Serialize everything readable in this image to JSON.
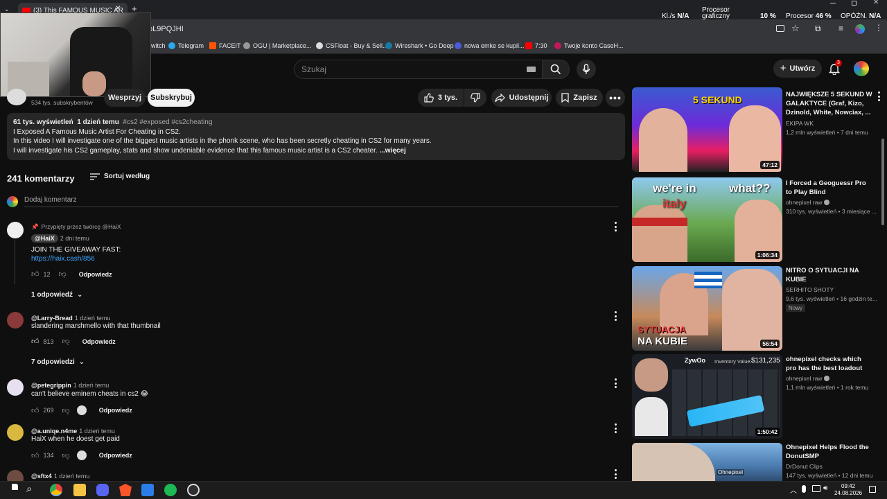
{
  "browser": {
    "tab_title": "(3) This FAMOUS MUSIC AR",
    "url_fragment": "oL9PQJHI",
    "bookmarks": [
      "witch",
      "Telegram",
      "FACEIT",
      "OGU | Marketplace...",
      "CSFloat - Buy & Sell...",
      "Wireshark • Go Deep",
      "nowa emke se kupil...",
      "7:30",
      "Twoje konto CaseH..."
    ]
  },
  "perf": {
    "kl_label": "Kl./s",
    "kl_value": "N/A",
    "gpu_label_1": "Procesor",
    "gpu_label_2": "graficzny",
    "gpu_value": "10 %",
    "cpu_label": "Procesor",
    "cpu_value": "46 %",
    "lag_label": "OPÓŹN.",
    "lag_value": "N/A"
  },
  "youtube": {
    "search_placeholder": "Szukaj",
    "create_label": "Utwórz",
    "notifications_count": "3"
  },
  "channel": {
    "subscribers": "534 tys. subskrybentów",
    "support_label": "Wesprzyj",
    "subscribe_label": "Subskrybuj"
  },
  "actions": {
    "likes": "3 tys.",
    "share": "Udostępnij",
    "save": "Zapisz"
  },
  "description": {
    "views": "61 tys. wyświetleń",
    "date": "1 dzień temu",
    "tags": "#cs2 #exposed #cs2cheating",
    "line1": "I Exposed A Famous Music Artist For Cheating in CS2.",
    "line2": "In this video I will investigate one of the biggest music artists in the phonk scene, who has been secretly cheating in CS2 for many years.",
    "line3": "I will investigate his CS2 gameplay, stats and show undeniable evidence that this famous music artist is a CS2 cheater.",
    "more": "...więcej"
  },
  "comments_header": {
    "count": "241 komentarzy",
    "sort": "Sortuj według",
    "add_placeholder": "Dodaj komentarz"
  },
  "comments": [
    {
      "pinned": "Przypięty przez twórcę @HaiX",
      "handle": "@HaiX",
      "time": "2 dni temu",
      "text": "JOIN THE GIVEAWAY FAST:",
      "link": "https://haix.cash/856",
      "likes": "12",
      "reply": "Odpowiedz",
      "replies": "1 odpowiedź"
    },
    {
      "handle": "@Larry-Bread",
      "time": "1 dzień temu",
      "text": "slandering marshmello with that thumbnail",
      "likes": "813",
      "reply": "Odpowiedz",
      "replies": "7 odpowiedzi"
    },
    {
      "handle": "@petegrippin",
      "time": "1 dzień temu",
      "text": "can't believe eminem cheats in cs2 😂",
      "likes": "269",
      "reply": "Odpowiedz"
    },
    {
      "handle": "@a.uniqe.n4me",
      "time": "1 dzień temu",
      "text": "HaiX when he doest get paid",
      "likes": "134",
      "reply": "Odpowiedz"
    },
    {
      "handle": "@sftx4",
      "time": "1 dzień temu"
    }
  ],
  "sidebar": [
    {
      "title": "NAJWIĘKSZE 5 SEKUND W GALAKTYCE (Graf, Kizo, Dzinold, White, Nowciax, ...",
      "channel": "EKIPA WK",
      "meta": "1,2 mln wyświetleń • 7 dni temu",
      "duration": "47:12",
      "thumb_text": "5 SEKUND"
    },
    {
      "title": "I Forced a Geoguessr Pro to Play Blind",
      "channel": "ohnepixel raw",
      "meta": "310 tys. wyświetleń • 3 miesiące ...",
      "duration": "1:06:34",
      "thumb_text_1": "we're in",
      "thumb_text_2": "italy",
      "thumb_text_3": "what??"
    },
    {
      "title": "NITRO O SYTUACJI NA KUBIE",
      "channel": "SERHITO SHOTY",
      "meta": "9,6 tys. wyświetleń • 16 godzin te...",
      "badge": "Nowy",
      "duration": "56:54",
      "thumb_text_1": "SYTUACJA",
      "thumb_text_2": "NA KUBIE"
    },
    {
      "title": "ohnepixel checks which pro has the best loadout",
      "channel": "ohnepixel raw",
      "meta": "1,1 mln wyświetleń • 1 rok temu",
      "duration": "1:50:42",
      "thumb_text_1": "ZywOo",
      "thumb_text_2": "Inventory Value:",
      "thumb_text_3": "$131,235"
    },
    {
      "title": "Ohnepixel Helps Flood the DonutSMP",
      "channel": "DrDonut Clips",
      "meta": "147 tys. wyświetleń • 12 dni temu",
      "thumb_text": "Ohnepixel"
    }
  ],
  "taskbar": {
    "time": "09:42",
    "date": "24.08.2026"
  },
  "colors": {
    "bg": "#0f0f0f",
    "surface": "#272727",
    "accent_red": "#ff0000",
    "link": "#3ea6ff",
    "secondary_text": "#aaaaaa"
  }
}
